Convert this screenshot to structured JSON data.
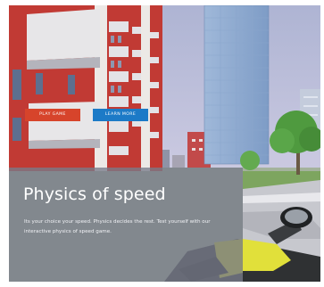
{
  "hero": {
    "title": "Physics of speed",
    "description": "Its your choice your speed. Physics decides the rest. Test yourself with our interactive physics of speed game."
  },
  "buttons": {
    "play_label": "PLAY GAME",
    "learn_label": "LEARN MORE"
  },
  "colors": {
    "play_button": "#d7442b",
    "learn_button": "#1c7ac7",
    "overlay": "#787c8a",
    "sky": "#b9bfd8"
  },
  "scene": {
    "icons": [
      "apartment-building-red",
      "glass-tower",
      "tree",
      "road",
      "motorbike-handlebar"
    ]
  }
}
